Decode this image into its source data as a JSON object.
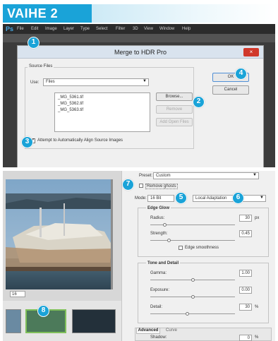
{
  "step": {
    "label": "VAIHE 2"
  },
  "app_menu": {
    "logo": "Ps",
    "items": [
      "File",
      "Edit",
      "Image",
      "Layer",
      "Type",
      "Select",
      "Filter",
      "3D",
      "View",
      "Window",
      "Help"
    ]
  },
  "dialog": {
    "title": "Merge to HDR Pro",
    "close_label": "×",
    "source_files_group": "Source Files",
    "use_label": "Use:",
    "use_value": "Files",
    "files": [
      "_MG_5361.tif",
      "_MG_5362.tif",
      "_MG_5363.tif"
    ],
    "browse_label": "Browse...",
    "remove_label": "Remove",
    "add_open_label": "Add Open Files",
    "ok_label": "OK",
    "cancel_label": "Cancel",
    "align_label": "Attempt to Automatically Align Source Images",
    "align_checked_glyph": "✔"
  },
  "hdr_panel": {
    "preset_label": "Preset:",
    "preset_value": "Custom",
    "remove_ghosts_label": "Remove ghosts",
    "mode_label": "Mode:",
    "mode_value": "16 Bit",
    "method_value": "Local Adaptation",
    "edge_glow_heading": "Edge Glow",
    "radius_label": "Radius:",
    "radius_value": "30",
    "radius_unit": "px",
    "strength_label": "Strength:",
    "strength_value": "0.45",
    "edge_smoothness_label": "Edge smoothness",
    "tone_detail_heading": "Tone and Detail",
    "gamma_label": "Gamma:",
    "gamma_value": "1.00",
    "exposure_label": "Exposure:",
    "exposure_value": "0.00",
    "detail_label": "Detail:",
    "detail_value": "30",
    "detail_unit": "%",
    "advanced_tab": "Advanced",
    "curve_tab": "Curve",
    "shadow_label": "Shadow:",
    "shadow_value": "0",
    "shadow_unit": "%"
  },
  "preview": {
    "zoom_value": "16"
  },
  "badges": [
    "1",
    "2",
    "3",
    "4",
    "5",
    "6",
    "7",
    "8"
  ],
  "colors": {
    "accent": "#1aa3d8",
    "close_red": "#d0382b"
  }
}
